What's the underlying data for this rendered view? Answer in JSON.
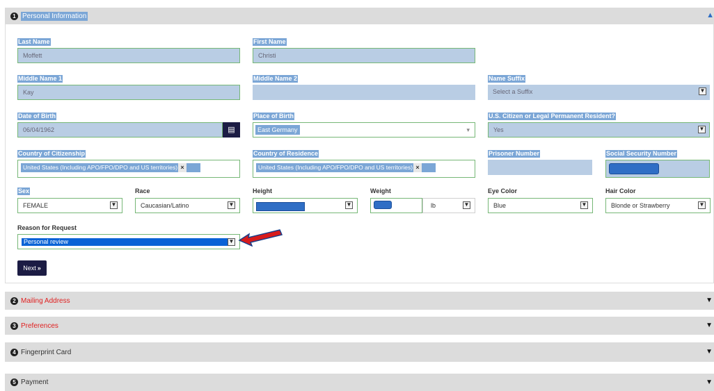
{
  "panels": {
    "personal": {
      "num": "1",
      "title": "Personal Information"
    },
    "mailing": {
      "num": "2",
      "title": "Mailing Address"
    },
    "preferences": {
      "num": "3",
      "title": "Preferences"
    },
    "fingerprint": {
      "num": "4",
      "title": "Fingerprint Card"
    },
    "payment": {
      "num": "5",
      "title": "Payment"
    }
  },
  "fields": {
    "last_name": {
      "label": "Last Name",
      "value": "Moffett"
    },
    "first_name": {
      "label": "First Name",
      "value": "Christi"
    },
    "middle_name_1": {
      "label": "Middle Name 1",
      "value": "Kay"
    },
    "middle_name_2": {
      "label": "Middle Name 2",
      "value": ""
    },
    "name_suffix": {
      "label": "Name Suffix",
      "value": "Select a Suffix"
    },
    "dob": {
      "label": "Date of Birth",
      "value": "06/04/1962"
    },
    "place_of_birth": {
      "label": "Place of Birth",
      "value": "East Germany"
    },
    "citizen": {
      "label": "U.S. Citizen or Legal Permanent Resident?",
      "value": "Yes"
    },
    "country_citizenship": {
      "label": "Country of Citizenship",
      "value": "United States (Including APO/FPO/DPO and US territories)"
    },
    "country_residence": {
      "label": "Country of Residence",
      "value": "United States (Including APO/FPO/DPO and US territories)"
    },
    "prisoner_number": {
      "label": "Prisoner Number",
      "value": ""
    },
    "ssn": {
      "label": "Social Security Number",
      "value": ""
    },
    "sex": {
      "label": "Sex",
      "value": "FEMALE"
    },
    "race": {
      "label": "Race",
      "value": "Caucasian/Latino"
    },
    "height": {
      "label": "Height",
      "value": ""
    },
    "weight": {
      "label": "Weight",
      "value": "",
      "unit": "lb"
    },
    "eye_color": {
      "label": "Eye Color",
      "value": "Blue"
    },
    "hair_color": {
      "label": "Hair Color",
      "value": "Blonde or Strawberry"
    },
    "reason": {
      "label": "Reason for Request",
      "value": "Personal review"
    }
  },
  "buttons": {
    "next": "Next",
    "next_arrow": "»"
  },
  "glyphs": {
    "select_arrow": "▼",
    "remove": "×",
    "calendar": "▤",
    "collapse": "▲",
    "expand": "▼",
    "caret": "▾"
  },
  "colors": {
    "accent_error": "#e02020",
    "highlight": "#7ba6d6",
    "field_valid_border": "#76b776",
    "panel_bg": "#dcdcdc",
    "button_bg": "#1c1c44",
    "annotation_arrow": "#d81b1b"
  }
}
